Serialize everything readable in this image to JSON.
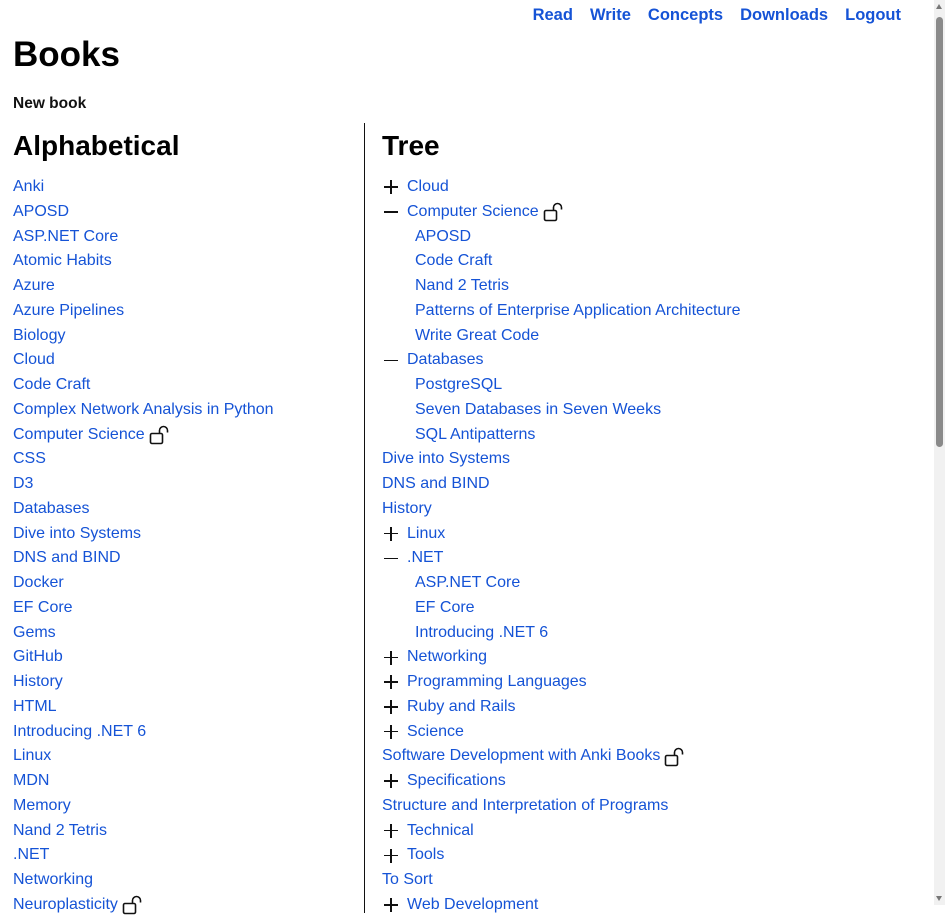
{
  "nav": {
    "read": "Read",
    "write": "Write",
    "concepts": "Concepts",
    "downloads": "Downloads",
    "logout": "Logout"
  },
  "page": {
    "title": "Books",
    "new_book": "New book"
  },
  "alphabetical": {
    "heading": "Alphabetical",
    "items": [
      {
        "label": "Anki",
        "locked": false
      },
      {
        "label": "APOSD",
        "locked": false
      },
      {
        "label": "ASP.NET Core",
        "locked": false
      },
      {
        "label": "Atomic Habits",
        "locked": false
      },
      {
        "label": "Azure",
        "locked": false
      },
      {
        "label": "Azure Pipelines",
        "locked": false
      },
      {
        "label": "Biology",
        "locked": false
      },
      {
        "label": "Cloud",
        "locked": false
      },
      {
        "label": "Code Craft",
        "locked": false
      },
      {
        "label": "Complex Network Analysis in Python",
        "locked": false
      },
      {
        "label": "Computer Science",
        "locked": true
      },
      {
        "label": "CSS",
        "locked": false
      },
      {
        "label": "D3",
        "locked": false
      },
      {
        "label": "Databases",
        "locked": false
      },
      {
        "label": "Dive into Systems",
        "locked": false
      },
      {
        "label": "DNS and BIND",
        "locked": false
      },
      {
        "label": "Docker",
        "locked": false
      },
      {
        "label": "EF Core",
        "locked": false
      },
      {
        "label": "Gems",
        "locked": false
      },
      {
        "label": "GitHub",
        "locked": false
      },
      {
        "label": "History",
        "locked": false
      },
      {
        "label": "HTML",
        "locked": false
      },
      {
        "label": "Introducing .NET 6",
        "locked": false
      },
      {
        "label": "Linux",
        "locked": false
      },
      {
        "label": "MDN",
        "locked": false
      },
      {
        "label": "Memory",
        "locked": false
      },
      {
        "label": "Nand 2 Tetris",
        "locked": false
      },
      {
        "label": ".NET",
        "locked": false
      },
      {
        "label": "Networking",
        "locked": false
      },
      {
        "label": "Neuroplasticity",
        "locked": true
      }
    ]
  },
  "tree": {
    "heading": "Tree",
    "items": [
      {
        "label": "Cloud",
        "toggle": "plus",
        "child": false,
        "locked": false
      },
      {
        "label": "Computer Science",
        "toggle": "minus",
        "child": false,
        "locked": true
      },
      {
        "label": "APOSD",
        "toggle": "none",
        "child": true,
        "locked": false
      },
      {
        "label": "Code Craft",
        "toggle": "none",
        "child": true,
        "locked": false
      },
      {
        "label": "Nand 2 Tetris",
        "toggle": "none",
        "child": true,
        "locked": false
      },
      {
        "label": "Patterns of Enterprise Application Architecture",
        "toggle": "none",
        "child": true,
        "locked": false
      },
      {
        "label": "Write Great Code",
        "toggle": "none",
        "child": true,
        "locked": false
      },
      {
        "label": "Databases",
        "toggle": "minus",
        "child": false,
        "locked": false
      },
      {
        "label": "PostgreSQL",
        "toggle": "none",
        "child": true,
        "locked": false
      },
      {
        "label": "Seven Databases in Seven Weeks",
        "toggle": "none",
        "child": true,
        "locked": false
      },
      {
        "label": "SQL Antipatterns",
        "toggle": "none",
        "child": true,
        "locked": false
      },
      {
        "label": "Dive into Systems",
        "toggle": "none",
        "child": false,
        "locked": false
      },
      {
        "label": "DNS and BIND",
        "toggle": "none",
        "child": false,
        "locked": false
      },
      {
        "label": "History",
        "toggle": "none",
        "child": false,
        "locked": false
      },
      {
        "label": "Linux",
        "toggle": "plus",
        "child": false,
        "locked": false
      },
      {
        "label": ".NET",
        "toggle": "minus",
        "child": false,
        "locked": false
      },
      {
        "label": "ASP.NET Core",
        "toggle": "none",
        "child": true,
        "locked": false
      },
      {
        "label": "EF Core",
        "toggle": "none",
        "child": true,
        "locked": false
      },
      {
        "label": "Introducing .NET 6",
        "toggle": "none",
        "child": true,
        "locked": false
      },
      {
        "label": "Networking",
        "toggle": "plus",
        "child": false,
        "locked": false
      },
      {
        "label": "Programming Languages",
        "toggle": "plus",
        "child": false,
        "locked": false
      },
      {
        "label": "Ruby and Rails",
        "toggle": "plus",
        "child": false,
        "locked": false
      },
      {
        "label": "Science",
        "toggle": "plus",
        "child": false,
        "locked": false
      },
      {
        "label": "Software Development with Anki Books",
        "toggle": "none",
        "child": false,
        "locked": true
      },
      {
        "label": "Specifications",
        "toggle": "plus",
        "child": false,
        "locked": false
      },
      {
        "label": "Structure and Interpretation of Programs",
        "toggle": "none",
        "child": false,
        "locked": false
      },
      {
        "label": "Technical",
        "toggle": "plus",
        "child": false,
        "locked": false
      },
      {
        "label": "Tools",
        "toggle": "plus",
        "child": false,
        "locked": false
      },
      {
        "label": "To Sort",
        "toggle": "none",
        "child": false,
        "locked": false
      },
      {
        "label": "Web Development",
        "toggle": "plus",
        "child": false,
        "locked": false
      }
    ]
  },
  "colors": {
    "link": "#1553d6",
    "text": "#111111",
    "background": "#ffffff"
  },
  "icons": {
    "lock": "unlocked-padlock-icon",
    "expand": "plus-icon",
    "collapse": "minus-icon"
  }
}
